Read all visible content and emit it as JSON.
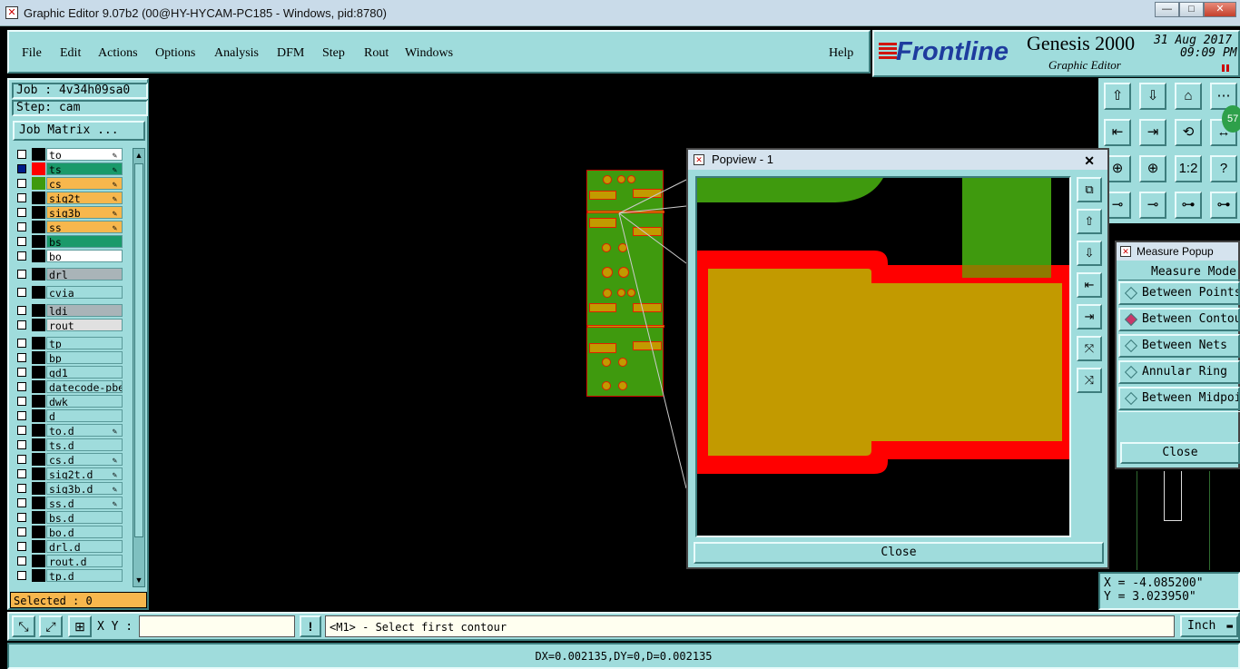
{
  "window": {
    "title": "Graphic Editor 9.07b2 (00@HY-HYCAM-PC185 - Windows, pid:8780)",
    "minimize": "—",
    "maximize": "□",
    "close": "✕"
  },
  "menu": {
    "items": [
      "File",
      "Edit",
      "Actions",
      "Options",
      "Analysis",
      "DFM",
      "Step",
      "Rout",
      "Windows"
    ],
    "help": "Help"
  },
  "brand": {
    "logo": "Frontline",
    "product": "Genesis 2000",
    "subtitle": "Graphic Editor",
    "date": "31 Aug 2017",
    "time": "09:09 PM",
    "badge": "57"
  },
  "job": {
    "job_label": "Job : 4v34h09sa0",
    "step_label": "Step: cam",
    "matrix_button": "Job Matrix ..."
  },
  "layers": [
    {
      "name": "to",
      "color": "#ffffff",
      "swatch": "#000000",
      "pen": true
    },
    {
      "name": "ts",
      "color": "#1a9a6a",
      "swatch": "#ff0000",
      "pen": true,
      "selected": true
    },
    {
      "name": "cs",
      "color": "#f7b74d",
      "swatch": "#3f9a0e",
      "pen": true
    },
    {
      "name": "sig2t",
      "color": "#f7b74d",
      "swatch": "#000000",
      "pen": true
    },
    {
      "name": "sig3b",
      "color": "#f7b74d",
      "swatch": "#000000",
      "pen": true
    },
    {
      "name": "ss",
      "color": "#f7b74d",
      "swatch": "#000000",
      "pen": true
    },
    {
      "name": "bs",
      "color": "#1a9a6a",
      "swatch": "#000000",
      "pen": false
    },
    {
      "name": "bo",
      "color": "#ffffff",
      "swatch": "#000000",
      "pen": false
    },
    {
      "name": "drl",
      "color": "#a9b4b8",
      "swatch": "#000000",
      "pen": false
    },
    {
      "name": "cvia",
      "color": "#9fdcdc",
      "swatch": "#000000",
      "pen": false
    },
    {
      "name": "ldi",
      "color": "#a9b4b8",
      "swatch": "#000000",
      "pen": false
    },
    {
      "name": "rout",
      "color": "#e0e0e0",
      "swatch": "#000000",
      "pen": false
    },
    {
      "name": "tp",
      "color": "#9fdcdc",
      "swatch": "#000000",
      "pen": false
    },
    {
      "name": "bp",
      "color": "#9fdcdc",
      "swatch": "#000000",
      "pen": false
    },
    {
      "name": "gd1",
      "color": "#9fdcdc",
      "swatch": "#000000",
      "pen": false
    },
    {
      "name": "datecode-pbe",
      "color": "#9fdcdc",
      "swatch": "#000000",
      "pen": false
    },
    {
      "name": "dwk",
      "color": "#9fdcdc",
      "swatch": "#000000",
      "pen": false
    },
    {
      "name": "d",
      "color": "#9fdcdc",
      "swatch": "#000000",
      "pen": false
    },
    {
      "name": "to.d",
      "color": "#9fdcdc",
      "swatch": "#000000",
      "pen": true
    },
    {
      "name": "ts.d",
      "color": "#9fdcdc",
      "swatch": "#000000",
      "pen": false
    },
    {
      "name": "cs.d",
      "color": "#9fdcdc",
      "swatch": "#000000",
      "pen": true
    },
    {
      "name": "sig2t.d",
      "color": "#9fdcdc",
      "swatch": "#000000",
      "pen": true
    },
    {
      "name": "sig3b.d",
      "color": "#9fdcdc",
      "swatch": "#000000",
      "pen": true
    },
    {
      "name": "ss.d",
      "color": "#9fdcdc",
      "swatch": "#000000",
      "pen": true
    },
    {
      "name": "bs.d",
      "color": "#9fdcdc",
      "swatch": "#000000",
      "pen": false
    },
    {
      "name": "bo.d",
      "color": "#9fdcdc",
      "swatch": "#000000",
      "pen": false
    },
    {
      "name": "drl.d",
      "color": "#9fdcdc",
      "swatch": "#000000",
      "pen": false
    },
    {
      "name": "rout.d",
      "color": "#9fdcdc",
      "swatch": "#000000",
      "pen": false
    },
    {
      "name": "tp.d",
      "color": "#9fdcdc",
      "swatch": "#000000",
      "pen": false
    }
  ],
  "selected_label": "Selected : 0",
  "popview": {
    "title": "Popview - 1",
    "close_label": "Close"
  },
  "measure": {
    "title": "Measure Popup",
    "header": "Measure Mode",
    "options": [
      "Between Points",
      "Between Contours",
      "Between Nets",
      "Annular Ring",
      "Between Midpoints"
    ],
    "selected": 1,
    "close_label": "Close"
  },
  "coords": {
    "x": "X = -4.085200\"",
    "y": "Y = 3.023950\""
  },
  "command": {
    "xy_label": "X Y :",
    "xy_value": "",
    "prompt": "<M1> - Select first contour",
    "units": "Inch"
  },
  "status": "DX=0.002135,DY=0,D=0.002135",
  "tools": {
    "main": [
      "⇧",
      "⇩",
      "⌂",
      "⋯",
      "⇤",
      "⇥",
      "⟲",
      "↔",
      "⊕",
      "⊕",
      "1:2",
      "?",
      "⊸",
      "⊸",
      "⊶",
      "⊶"
    ],
    "popview": [
      "⧉",
      "⇧",
      "⇩",
      "⇤",
      "⇥",
      "⤧",
      "⤨"
    ]
  }
}
